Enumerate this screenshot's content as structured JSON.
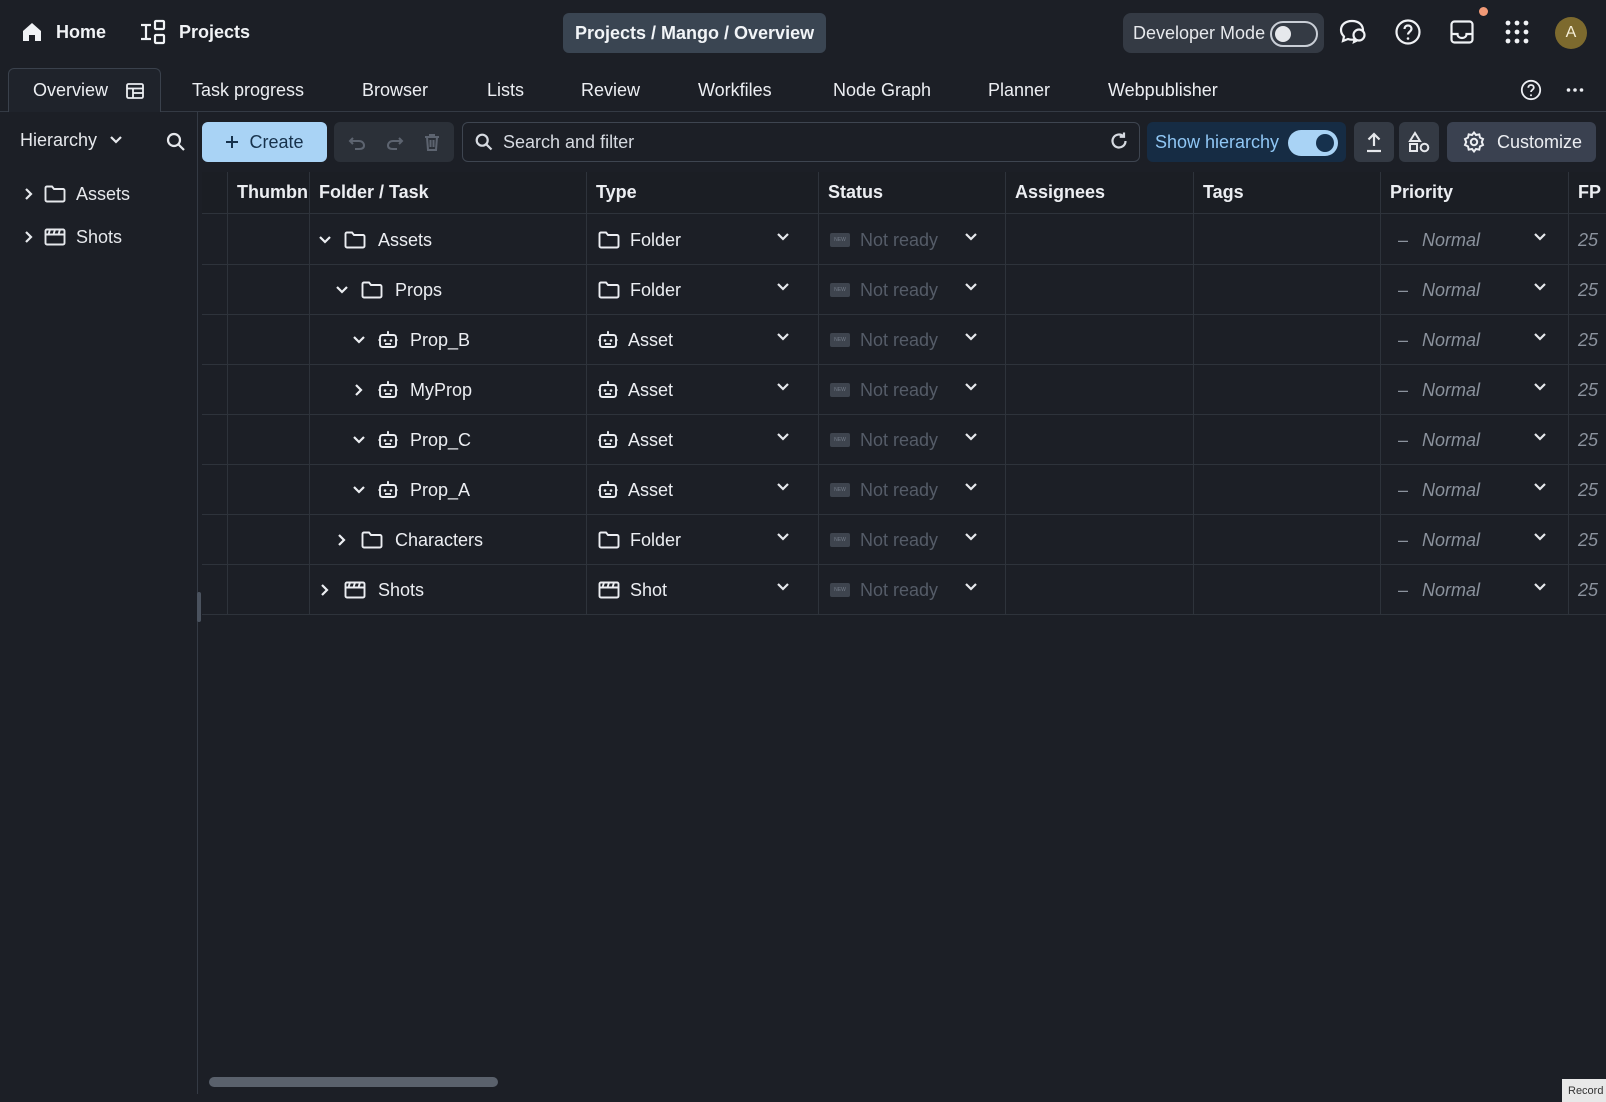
{
  "topbar": {
    "home_label": "Home",
    "projects_label": "Projects",
    "breadcrumb": "Projects / Mango / Overview",
    "developer_mode_label": "Developer Mode",
    "developer_mode_on": false,
    "avatar_initial": "A"
  },
  "tabs": [
    {
      "label": "Overview",
      "active": true
    },
    {
      "label": "Task progress"
    },
    {
      "label": "Browser"
    },
    {
      "label": "Lists"
    },
    {
      "label": "Review"
    },
    {
      "label": "Workfiles"
    },
    {
      "label": "Node Graph"
    },
    {
      "label": "Planner"
    },
    {
      "label": "Webpublisher"
    }
  ],
  "sidebar": {
    "selector_label": "Hierarchy",
    "items": [
      {
        "label": "Assets",
        "icon": "folder-icon"
      },
      {
        "label": "Shots",
        "icon": "clapperboard-icon"
      }
    ]
  },
  "toolbar": {
    "create_label": "Create",
    "search_placeholder": "Search and filter",
    "show_hierarchy_label": "Show hierarchy",
    "show_hierarchy_on": true,
    "customize_label": "Customize"
  },
  "grid": {
    "columns": [
      "Thumbn",
      "Folder / Task",
      "Type",
      "Status",
      "Assignees",
      "Tags",
      "Priority",
      "FP"
    ],
    "rows": [
      {
        "name": "Assets",
        "expanded": true,
        "icon": "folder-icon",
        "type": "Folder",
        "type_icon": "folder-icon",
        "status": "Not ready",
        "priority": "Normal",
        "fp": "25"
      },
      {
        "name": "Props",
        "expanded": true,
        "icon": "folder-icon",
        "type": "Folder",
        "type_icon": "folder-icon",
        "status": "Not ready",
        "priority": "Normal",
        "fp": "25"
      },
      {
        "name": "Prop_B",
        "expanded": true,
        "icon": "asset-icon",
        "type": "Asset",
        "type_icon": "asset-icon",
        "status": "Not ready",
        "priority": "Normal",
        "fp": "25"
      },
      {
        "name": "MyProp",
        "expanded": false,
        "icon": "asset-icon",
        "type": "Asset",
        "type_icon": "asset-icon",
        "status": "Not ready",
        "priority": "Normal",
        "fp": "25"
      },
      {
        "name": "Prop_C",
        "expanded": true,
        "icon": "asset-icon",
        "type": "Asset",
        "type_icon": "asset-icon",
        "status": "Not ready",
        "priority": "Normal",
        "fp": "25"
      },
      {
        "name": "Prop_A",
        "expanded": true,
        "icon": "asset-icon",
        "type": "Asset",
        "type_icon": "asset-icon",
        "status": "Not ready",
        "priority": "Normal",
        "fp": "25"
      },
      {
        "name": "Characters",
        "expanded": false,
        "icon": "folder-icon",
        "type": "Folder",
        "type_icon": "folder-icon",
        "status": "Not ready",
        "priority": "Normal",
        "fp": "25"
      },
      {
        "name": "Shots",
        "expanded": false,
        "icon": "clapperboard-icon",
        "type": "Shot",
        "type_icon": "clapperboard-icon",
        "status": "Not ready",
        "priority": "Normal",
        "fp": "25"
      }
    ],
    "status_badge_text": "NEW",
    "priority_prefix": "–"
  },
  "footer": {
    "record_label": "Record"
  },
  "colors": {
    "background": "#1c1f26",
    "accent": "#a9d3f5",
    "notification": "#f19a77"
  }
}
